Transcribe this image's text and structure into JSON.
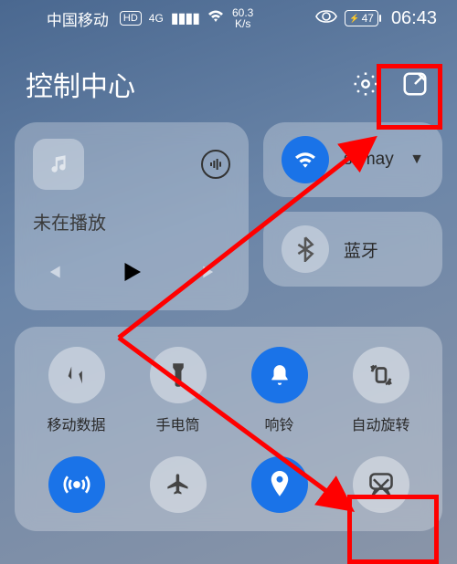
{
  "status": {
    "carrier": "中国移动",
    "hd": "HD",
    "net": "4G",
    "speed_top": "60.3",
    "speed_bot": "K/s",
    "battery": "47",
    "time": "06:43"
  },
  "header": {
    "title": "控制中心"
  },
  "media": {
    "status": "未在播放"
  },
  "conn": {
    "wifi_label": "ssmay",
    "bt_label": "蓝牙"
  },
  "tiles": {
    "r1": [
      "移动数据",
      "手电筒",
      "响铃",
      "自动旋转"
    ],
    "r2": [
      "",
      "",
      "",
      ""
    ]
  },
  "colors": {
    "accent": "#1a73e8",
    "anno": "#f00"
  }
}
